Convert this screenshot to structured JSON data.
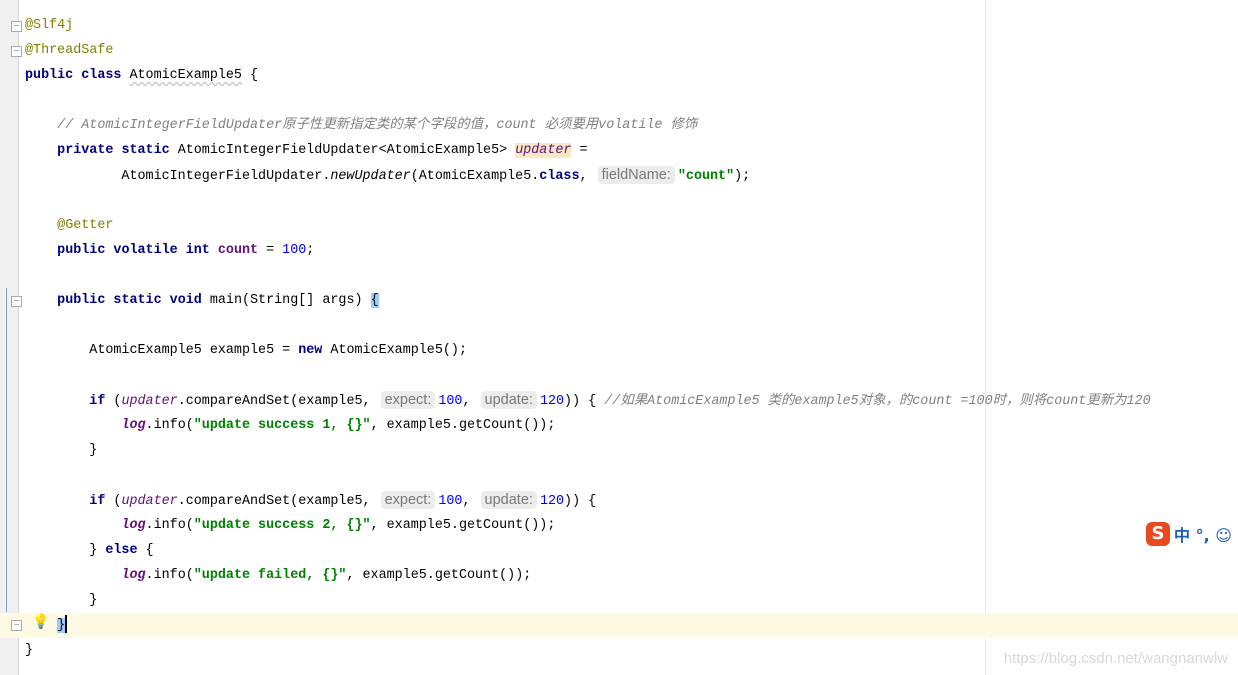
{
  "editor": {
    "current_line": 25,
    "lines": [
      [
        [
          "ann",
          "@Slf4j"
        ]
      ],
      [
        [
          "ann",
          "@ThreadSafe"
        ]
      ],
      [
        [
          "kw",
          "public class "
        ],
        [
          "warn",
          "AtomicExample5"
        ],
        [
          "plain",
          " {"
        ]
      ],
      [],
      [
        [
          "plain",
          "    "
        ],
        [
          "cmt",
          "// AtomicIntegerFieldUpdater原子性更新指定类的某个字段的值，count 必须要用volatile 修饰"
        ]
      ],
      [
        [
          "plain",
          "    "
        ],
        [
          "kw",
          "private static "
        ],
        [
          "plain",
          "AtomicIntegerFieldUpdater<AtomicExample5> "
        ],
        [
          "sfield-hl",
          "updater"
        ],
        [
          "plain",
          " ="
        ]
      ],
      [
        [
          "plain",
          "            AtomicIntegerFieldUpdater."
        ],
        [
          "ital",
          "newUpdater"
        ],
        [
          "plain",
          "(AtomicExample5."
        ],
        [
          "kw",
          "class"
        ],
        [
          "plain",
          ", "
        ],
        [
          "hint",
          "fieldName:"
        ],
        [
          "str",
          "\"count\""
        ],
        [
          "plain",
          ");"
        ]
      ],
      [],
      [
        [
          "plain",
          "    "
        ],
        [
          "ann",
          "@Getter"
        ]
      ],
      [
        [
          "plain",
          "    "
        ],
        [
          "kw",
          "public volatile int "
        ],
        [
          "field",
          "count"
        ],
        [
          "plain",
          " = "
        ],
        [
          "num",
          "100"
        ],
        [
          "plain",
          ";"
        ]
      ],
      [],
      [
        [
          "plain",
          "    "
        ],
        [
          "kw",
          "public static void "
        ],
        [
          "plain",
          "main(String[] args) "
        ],
        [
          "brace",
          "{"
        ]
      ],
      [],
      [
        [
          "plain",
          "        AtomicExample5 example5 = "
        ],
        [
          "kw",
          "new "
        ],
        [
          "plain",
          "AtomicExample5();"
        ]
      ],
      [],
      [
        [
          "plain",
          "        "
        ],
        [
          "kw",
          "if "
        ],
        [
          "plain",
          "("
        ],
        [
          "sfield",
          "updater"
        ],
        [
          "plain",
          ".compareAndSet(example5, "
        ],
        [
          "hint",
          "expect:"
        ],
        [
          "num",
          "100"
        ],
        [
          "plain",
          ", "
        ],
        [
          "hint",
          "update:"
        ],
        [
          "num",
          "120"
        ],
        [
          "plain",
          ")) { "
        ],
        [
          "cmt",
          "//如果AtomicExample5 类的example5对象，的count =100时，则将count更新为120"
        ]
      ],
      [
        [
          "plain",
          "            "
        ],
        [
          "slog",
          "log"
        ],
        [
          "plain",
          ".info("
        ],
        [
          "str",
          "\"update success 1, {}\""
        ],
        [
          "plain",
          ", example5.getCount());"
        ]
      ],
      [
        [
          "plain",
          "        }"
        ]
      ],
      [],
      [
        [
          "plain",
          "        "
        ],
        [
          "kw",
          "if "
        ],
        [
          "plain",
          "("
        ],
        [
          "sfield",
          "updater"
        ],
        [
          "plain",
          ".compareAndSet(example5, "
        ],
        [
          "hint",
          "expect:"
        ],
        [
          "num",
          "100"
        ],
        [
          "plain",
          ", "
        ],
        [
          "hint",
          "update:"
        ],
        [
          "num",
          "120"
        ],
        [
          "plain",
          ")) {"
        ]
      ],
      [
        [
          "plain",
          "            "
        ],
        [
          "slog",
          "log"
        ],
        [
          "plain",
          ".info("
        ],
        [
          "str",
          "\"update success 2, {}\""
        ],
        [
          "plain",
          ", example5.getCount());"
        ]
      ],
      [
        [
          "plain",
          "        } "
        ],
        [
          "kw",
          "else "
        ],
        [
          "plain",
          "{"
        ]
      ],
      [
        [
          "plain",
          "            "
        ],
        [
          "slog",
          "log"
        ],
        [
          "plain",
          ".info("
        ],
        [
          "str",
          "\"update failed, {}\""
        ],
        [
          "plain",
          ", example5.getCount());"
        ]
      ],
      [
        [
          "plain",
          "        }"
        ]
      ],
      [
        [
          "plain",
          "    "
        ],
        [
          "brace-caret",
          "}"
        ]
      ],
      [
        [
          "plain",
          "}"
        ]
      ]
    ]
  },
  "ime": {
    "logo": "S",
    "text": "中 °, ☺"
  },
  "watermark": "https://blog.csdn.net/wangnanwlw",
  "icons": {
    "gutter": "intention-bulb-icon",
    "fold": "fold-marker-icon"
  },
  "colors": {
    "keyword": "#000080",
    "annotation": "#808000",
    "string": "#008000",
    "number": "#0000ff",
    "field": "#660e7a",
    "comment": "#808080",
    "current_line": "#fdf9e3"
  }
}
